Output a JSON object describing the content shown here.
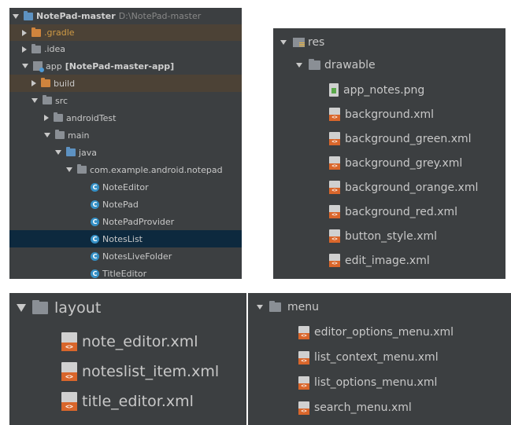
{
  "project_tree": {
    "root": {
      "name": "NotePad-master",
      "path": "D:\\NotePad-master"
    },
    "gradle": ".gradle",
    "idea": ".idea",
    "app": {
      "name": "app",
      "module": "[NotePad-master-app]"
    },
    "build": "build",
    "src": "src",
    "androidTest": "androidTest",
    "main": "main",
    "java": "java",
    "package": "com.example.android.notepad",
    "classes": [
      "NoteEditor",
      "NotePad",
      "NotePadProvider",
      "NotesList",
      "NotesLiveFolder",
      "TitleEditor"
    ],
    "selected": "NotesList"
  },
  "res_tree": {
    "res": "res",
    "drawable": "drawable",
    "files": [
      "app_notes.png",
      "background.xml",
      "background_green.xml",
      "background_grey.xml",
      "background_orange.xml",
      "background_red.xml",
      "button_style.xml",
      "edit_image.xml"
    ]
  },
  "layout_tree": {
    "folder": "layout",
    "files": [
      "note_editor.xml",
      "noteslist_item.xml",
      "title_editor.xml"
    ]
  },
  "menu_tree": {
    "folder": "menu",
    "files": [
      "editor_options_menu.xml",
      "list_context_menu.xml",
      "list_options_menu.xml",
      "search_menu.xml"
    ]
  }
}
